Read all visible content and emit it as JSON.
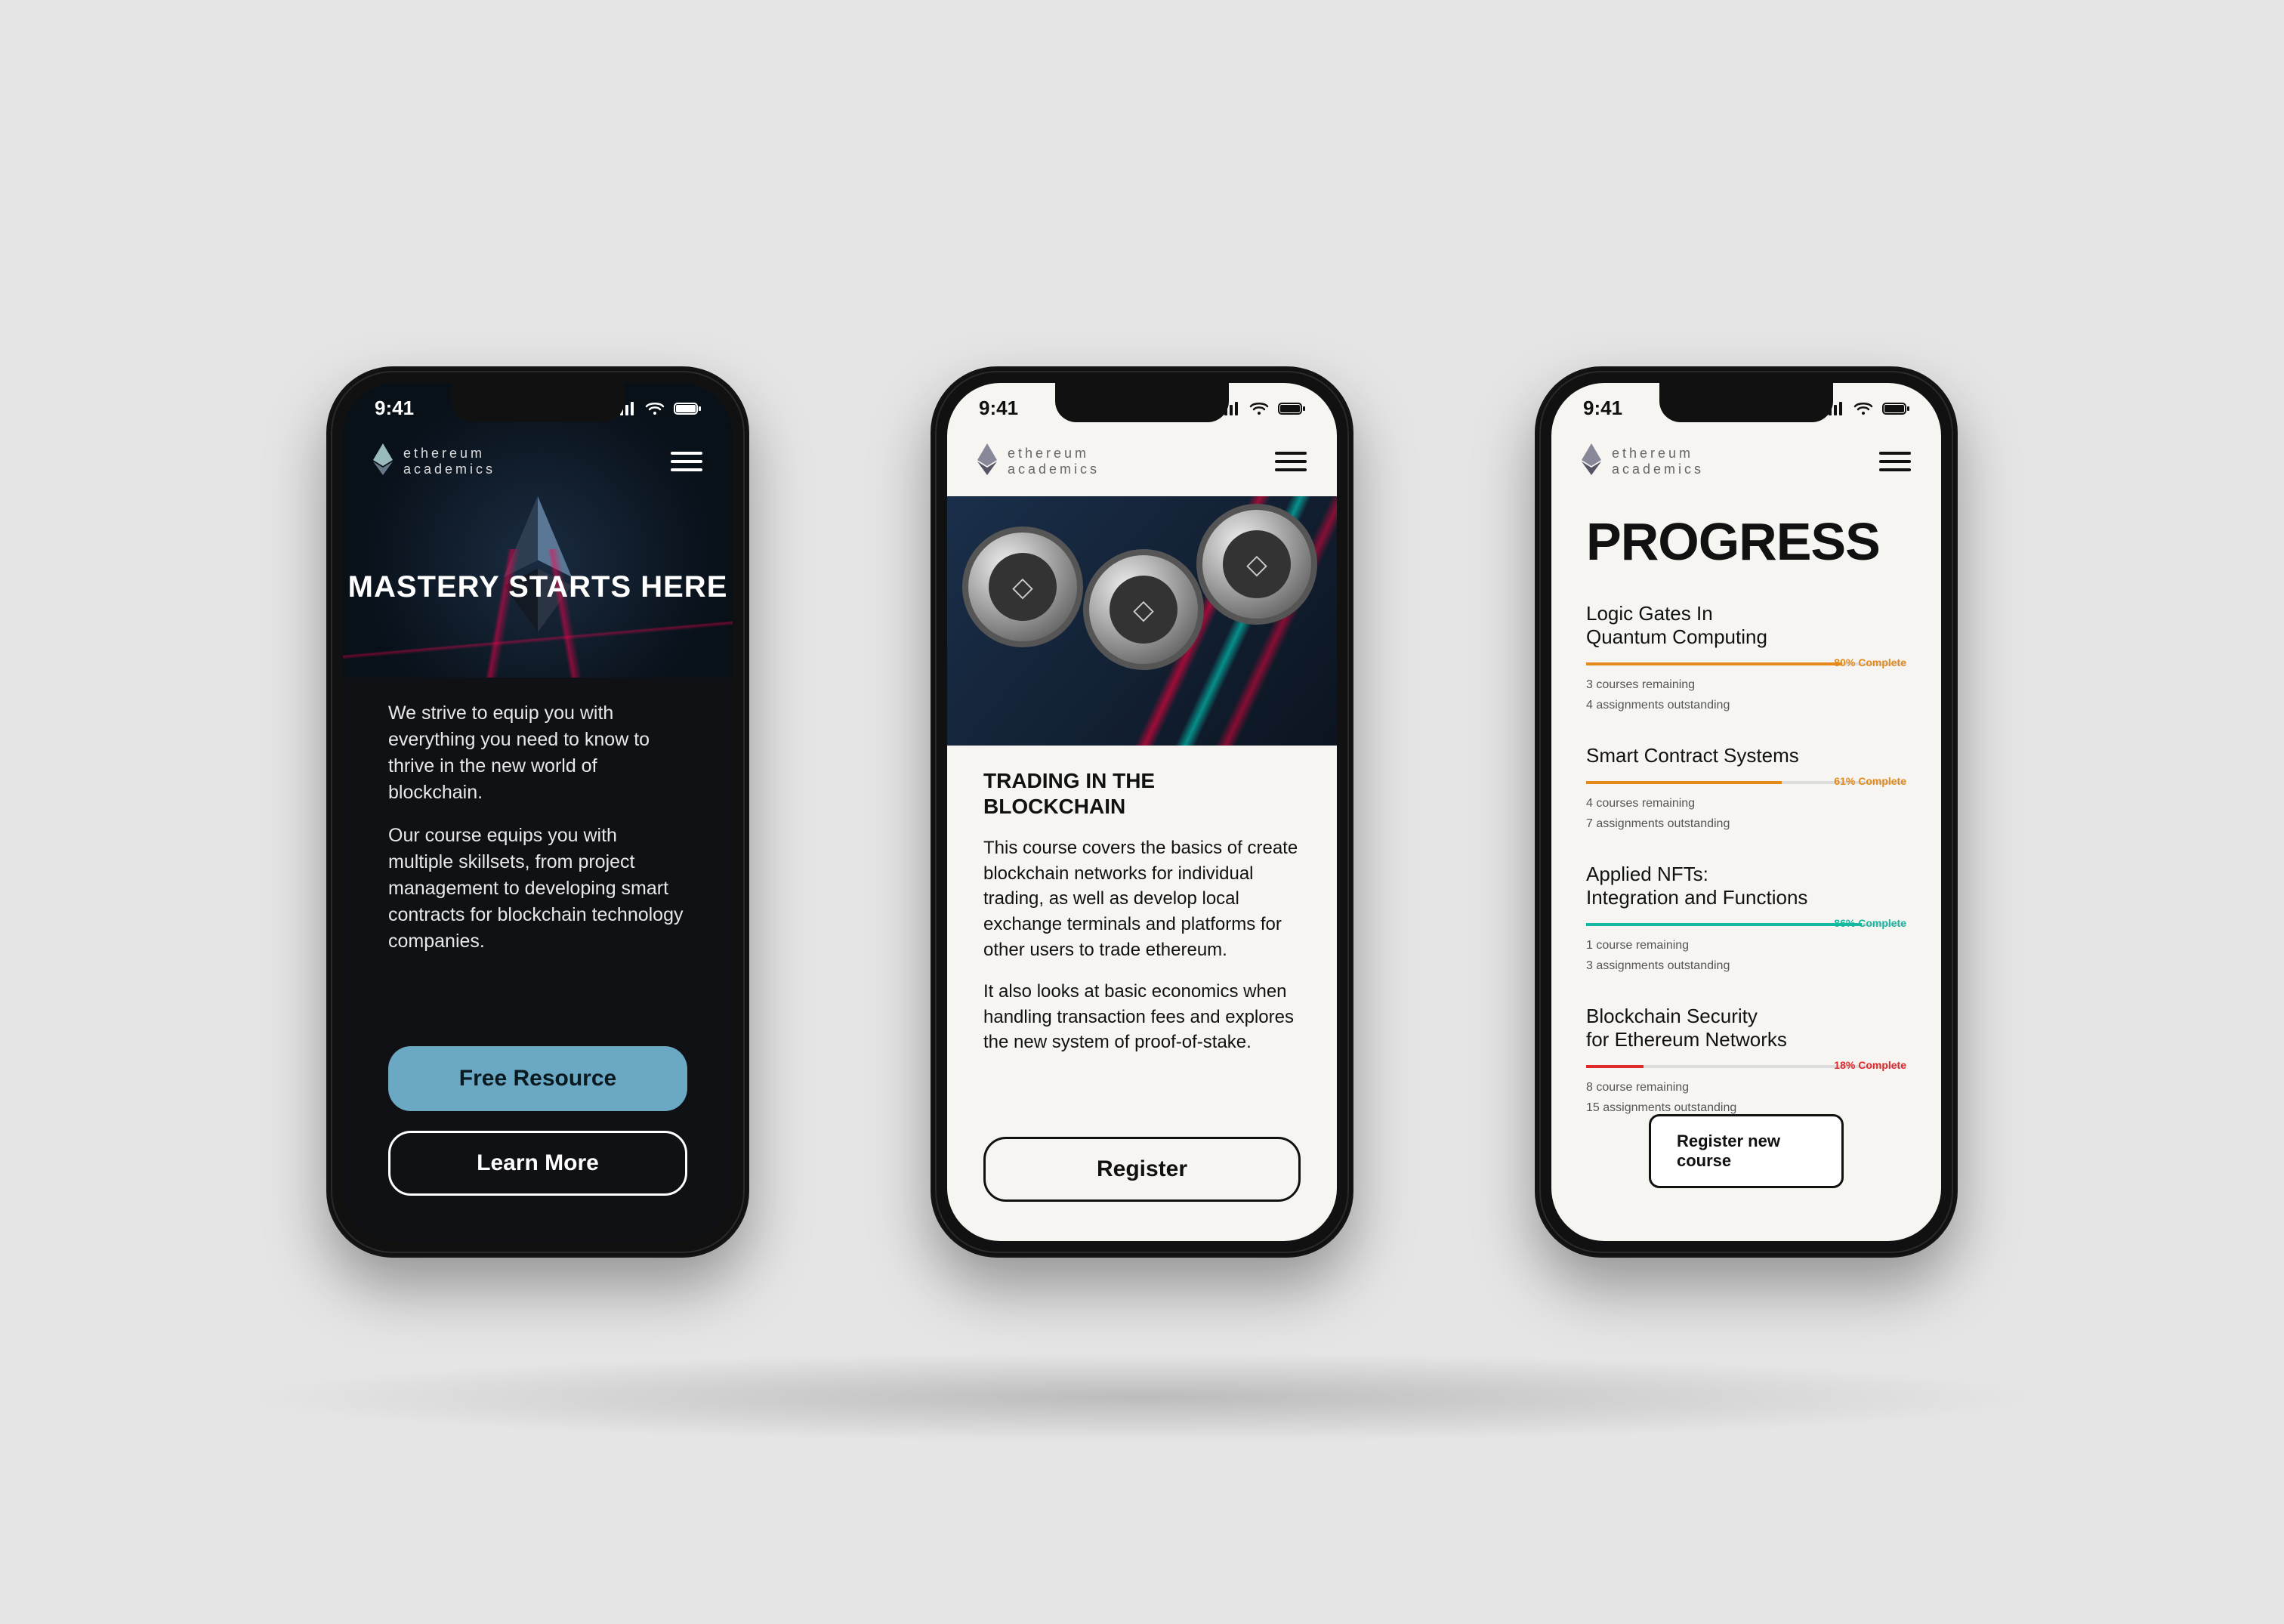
{
  "status": {
    "time": "9:41"
  },
  "brand": {
    "line1": "ethereum",
    "line2": "academics"
  },
  "colors": {
    "accent_blue": "#6aa8c4",
    "orange": "#e48a1a",
    "teal": "#15b8a0",
    "red": "#e02a2a"
  },
  "phone1": {
    "hero_title": "MASTERY STARTS HERE",
    "para1": "We strive to equip you with everything you need to know to thrive in the new world of blockchain.",
    "para2": "Our course equips you with multiple skillsets, from project management to developing smart contracts for blockchain technology companies.",
    "cta1": "Free Resource",
    "cta2": "Learn More"
  },
  "phone2": {
    "title": "TRADING IN THE BLOCKCHAIN",
    "para1": "This course covers the basics of create blockchain networks for individual trading, as well as develop local exchange terminals and platforms for other users to trade ethereum.",
    "para2": "It also looks at basic economics when handling transaction fees and explores the new system of proof-of-stake.",
    "cta": "Register"
  },
  "phone3": {
    "title": "PROGRESS",
    "courses": [
      {
        "name": "Logic Gates In\nQuantum Computing",
        "percent": 80,
        "percent_label": "80% Complete",
        "sub1": "3 courses remaining",
        "sub2": "4 assignments outstanding",
        "bar_color": "#e48a1a"
      },
      {
        "name": "Smart Contract Systems",
        "percent": 61,
        "percent_label": "61% Complete",
        "sub1": "4 courses remaining",
        "sub2": "7 assignments outstanding",
        "bar_color": "#e48a1a"
      },
      {
        "name": "Applied NFTs:\nIntegration and Functions",
        "percent": 86,
        "percent_label": "86% Complete",
        "sub1": "1 course remaining",
        "sub2": "3 assignments outstanding",
        "bar_color": "#15b8a0"
      },
      {
        "name": "Blockchain Security\nfor Ethereum Networks",
        "percent": 18,
        "percent_label": "18% Complete",
        "sub1": "8 course remaining",
        "sub2": "15 assignments outstanding",
        "bar_color": "#e02a2a"
      }
    ],
    "cta": "Register new course"
  }
}
